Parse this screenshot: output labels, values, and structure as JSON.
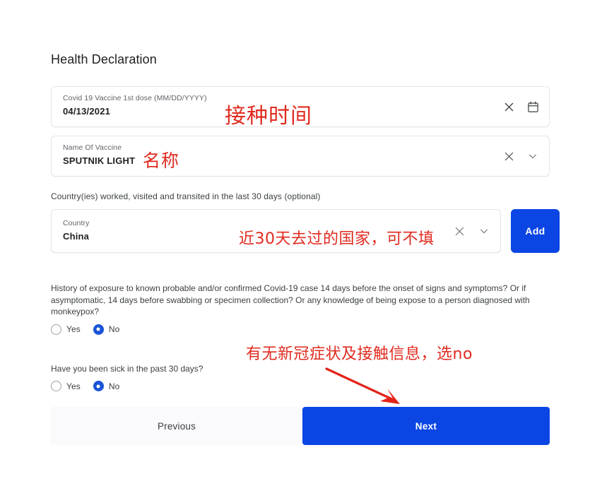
{
  "page": {
    "title": "Health Declaration"
  },
  "fields": {
    "vaccine_date": {
      "label": "Covid 19 Vaccine 1st dose (MM/DD/YYYY)",
      "value": "04/13/2021",
      "clear_icon": "close-icon",
      "picker_icon": "calendar-icon"
    },
    "vaccine_name": {
      "label": "Name Of Vaccine",
      "value": "SPUTNIK LIGHT",
      "clear_icon": "close-icon",
      "dropdown_icon": "chevron-down-icon"
    },
    "country": {
      "section_label": "Country(ies) worked, visited and transited in the last 30 days (optional)",
      "label": "Country",
      "value": "China",
      "clear_icon": "close-icon",
      "dropdown_icon": "chevron-down-icon",
      "add_label": "Add"
    }
  },
  "questions": [
    {
      "text": "History of exposure to known probable and/or confirmed Covid-19 case 14 days before the onset of signs and symptoms? Or if asymptomatic, 14 days before swabbing or specimen collection? Or any knowledge of being expose to a person diagnosed with monkeypox?",
      "yes_label": "Yes",
      "no_label": "No",
      "selected": "No"
    },
    {
      "text": "Have you been sick in the past 30 days?",
      "yes_label": "Yes",
      "no_label": "No",
      "selected": "No"
    }
  ],
  "footer": {
    "previous_label": "Previous",
    "next_label": "Next"
  },
  "annotations": {
    "date_note": "接种时间",
    "name_note": "名称",
    "country_note": "近30天去过的国家，可不填",
    "question_note": "有无新冠症状及接触信息，选no",
    "arrow": "red-arrow-icon"
  },
  "colors": {
    "primary_blue": "#0b45e4",
    "annotation_red": "#e02b20",
    "radio_selected": "#1a54d8",
    "field_border": "#e3e5e8",
    "label_gray": "#5f6368"
  }
}
